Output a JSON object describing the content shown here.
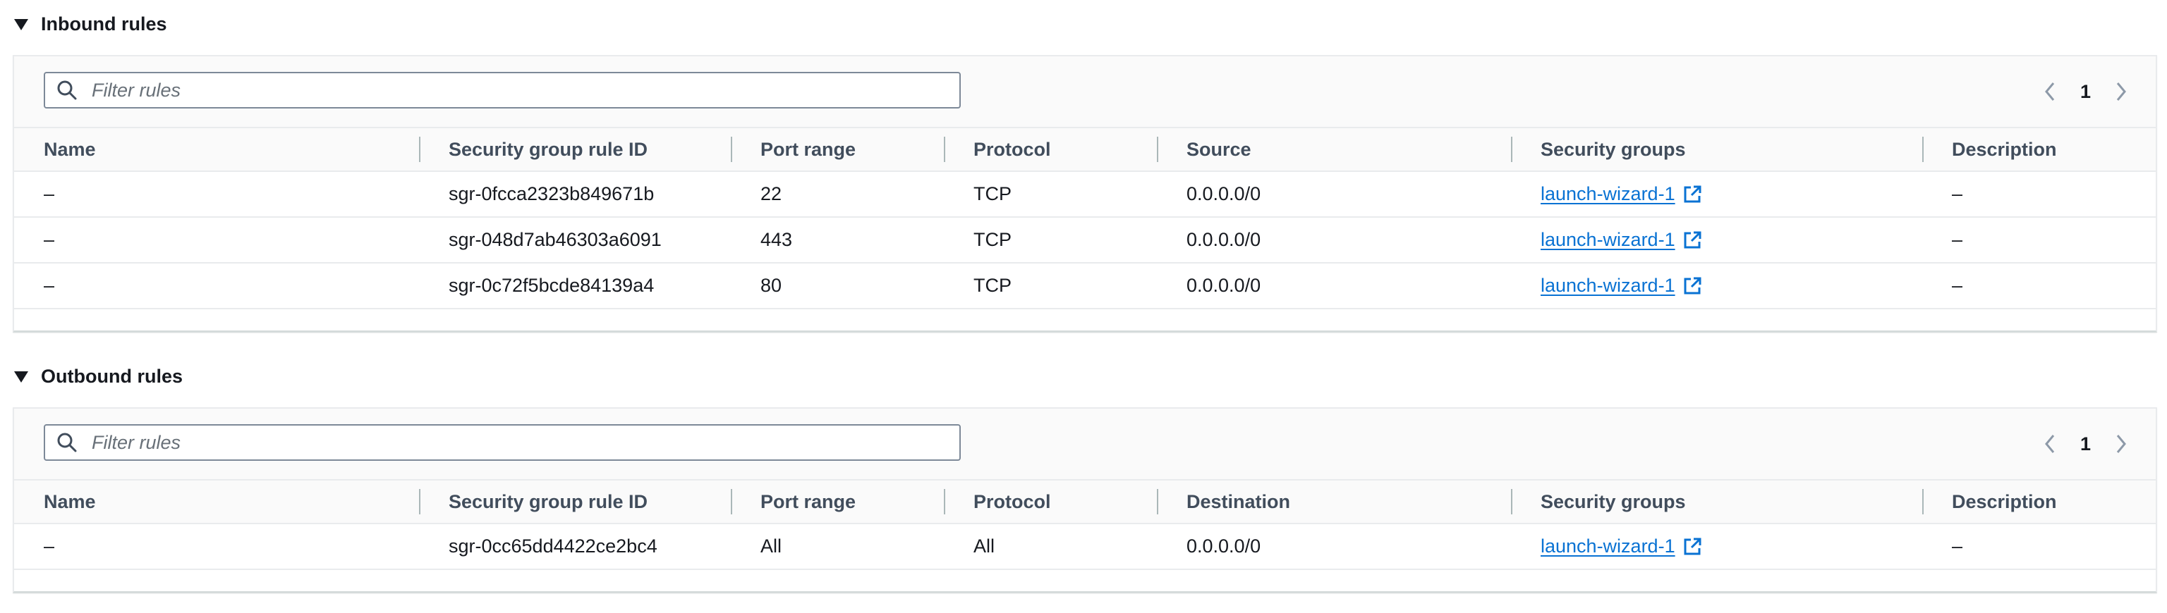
{
  "inbound": {
    "title": "Inbound rules",
    "filter_placeholder": "Filter rules",
    "page": "1",
    "columns": [
      "Name",
      "Security group rule ID",
      "Port range",
      "Protocol",
      "Source",
      "Security groups",
      "Description"
    ],
    "rows": [
      {
        "name": "–",
        "rule_id": "sgr-0fcca2323b849671b",
        "port": "22",
        "protocol": "TCP",
        "source": "0.0.0.0/0",
        "sg": "launch-wizard-1",
        "description": "–"
      },
      {
        "name": "–",
        "rule_id": "sgr-048d7ab46303a6091",
        "port": "443",
        "protocol": "TCP",
        "source": "0.0.0.0/0",
        "sg": "launch-wizard-1",
        "description": "–"
      },
      {
        "name": "–",
        "rule_id": "sgr-0c72f5bcde84139a4",
        "port": "80",
        "protocol": "TCP",
        "source": "0.0.0.0/0",
        "sg": "launch-wizard-1",
        "description": "–"
      }
    ]
  },
  "outbound": {
    "title": "Outbound rules",
    "filter_placeholder": "Filter rules",
    "page": "1",
    "columns": [
      "Name",
      "Security group rule ID",
      "Port range",
      "Protocol",
      "Destination",
      "Security groups",
      "Description"
    ],
    "rows": [
      {
        "name": "–",
        "rule_id": "sgr-0cc65dd4422ce2bc4",
        "port": "All",
        "protocol": "All",
        "source": "0.0.0.0/0",
        "sg": "launch-wizard-1",
        "description": "–"
      }
    ]
  },
  "icons": {
    "caret": "caret-down-icon",
    "search": "search-icon",
    "prev": "chevron-left-icon",
    "next": "chevron-right-icon",
    "external": "external-link-icon"
  },
  "colors": {
    "link": "#0972d3",
    "header_text": "#414d5c",
    "border": "#e9ebed"
  }
}
